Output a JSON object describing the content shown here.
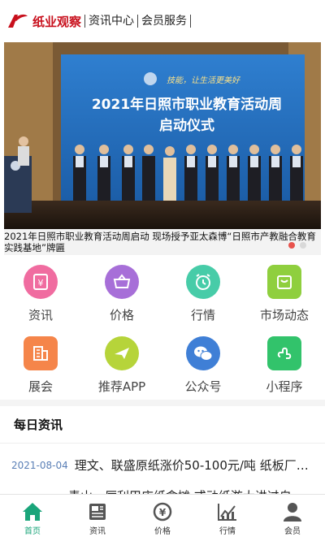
{
  "header": {
    "brand": "纸业观察",
    "links": [
      "资讯中心",
      "会员服务"
    ]
  },
  "banner": {
    "caption": "2021年日照市职业教育活动周启动 现场授予亚太森博“日照市产教融合教育实践基地”牌匾",
    "screen_slogan": "技能，让生活更美好",
    "screen_title": "2021年日照市职业教育活动周",
    "screen_subtitle": "启动仪式",
    "active_dot": 0
  },
  "grid": [
    {
      "label": "资讯",
      "icon": "info-icon",
      "color": "#f06ca0"
    },
    {
      "label": "价格",
      "icon": "basket-icon",
      "color": "#a76fd8"
    },
    {
      "label": "行情",
      "icon": "clock-icon",
      "color": "#47cca8"
    },
    {
      "label": "市场动态",
      "icon": "bag-icon",
      "color": "#8fcf3e"
    },
    {
      "label": "展会",
      "icon": "building-icon",
      "color": "#f5854a"
    },
    {
      "label": "推荐APP",
      "icon": "plane-icon",
      "color": "#b6d43a"
    },
    {
      "label": "公众号",
      "icon": "wechat-icon",
      "color": "#3f7fd6"
    },
    {
      "label": "小程序",
      "icon": "miniprogram-icon",
      "color": "#32c36b"
    }
  ],
  "news": {
    "title": "每日资讯",
    "items": [
      {
        "date": "2021-08-04",
        "text": "理文、联盛原纸涨价50-100元/吨 纸板厂…"
      },
      {
        "date": "",
        "text": "青山、厉利甲店纸盒摊 或动纸游大讲过自"
      }
    ]
  },
  "bottom_nav": [
    {
      "label": "首页",
      "icon": "home-icon",
      "active": true
    },
    {
      "label": "资讯",
      "icon": "news-icon",
      "active": false
    },
    {
      "label": "价格",
      "icon": "price-icon",
      "active": false
    },
    {
      "label": "行情",
      "icon": "trend-icon",
      "active": false
    },
    {
      "label": "会员",
      "icon": "user-icon",
      "active": false
    }
  ],
  "colors": {
    "brand": "#c8101d",
    "active_nav": "#1aa57a",
    "date": "#5a7fb6"
  }
}
